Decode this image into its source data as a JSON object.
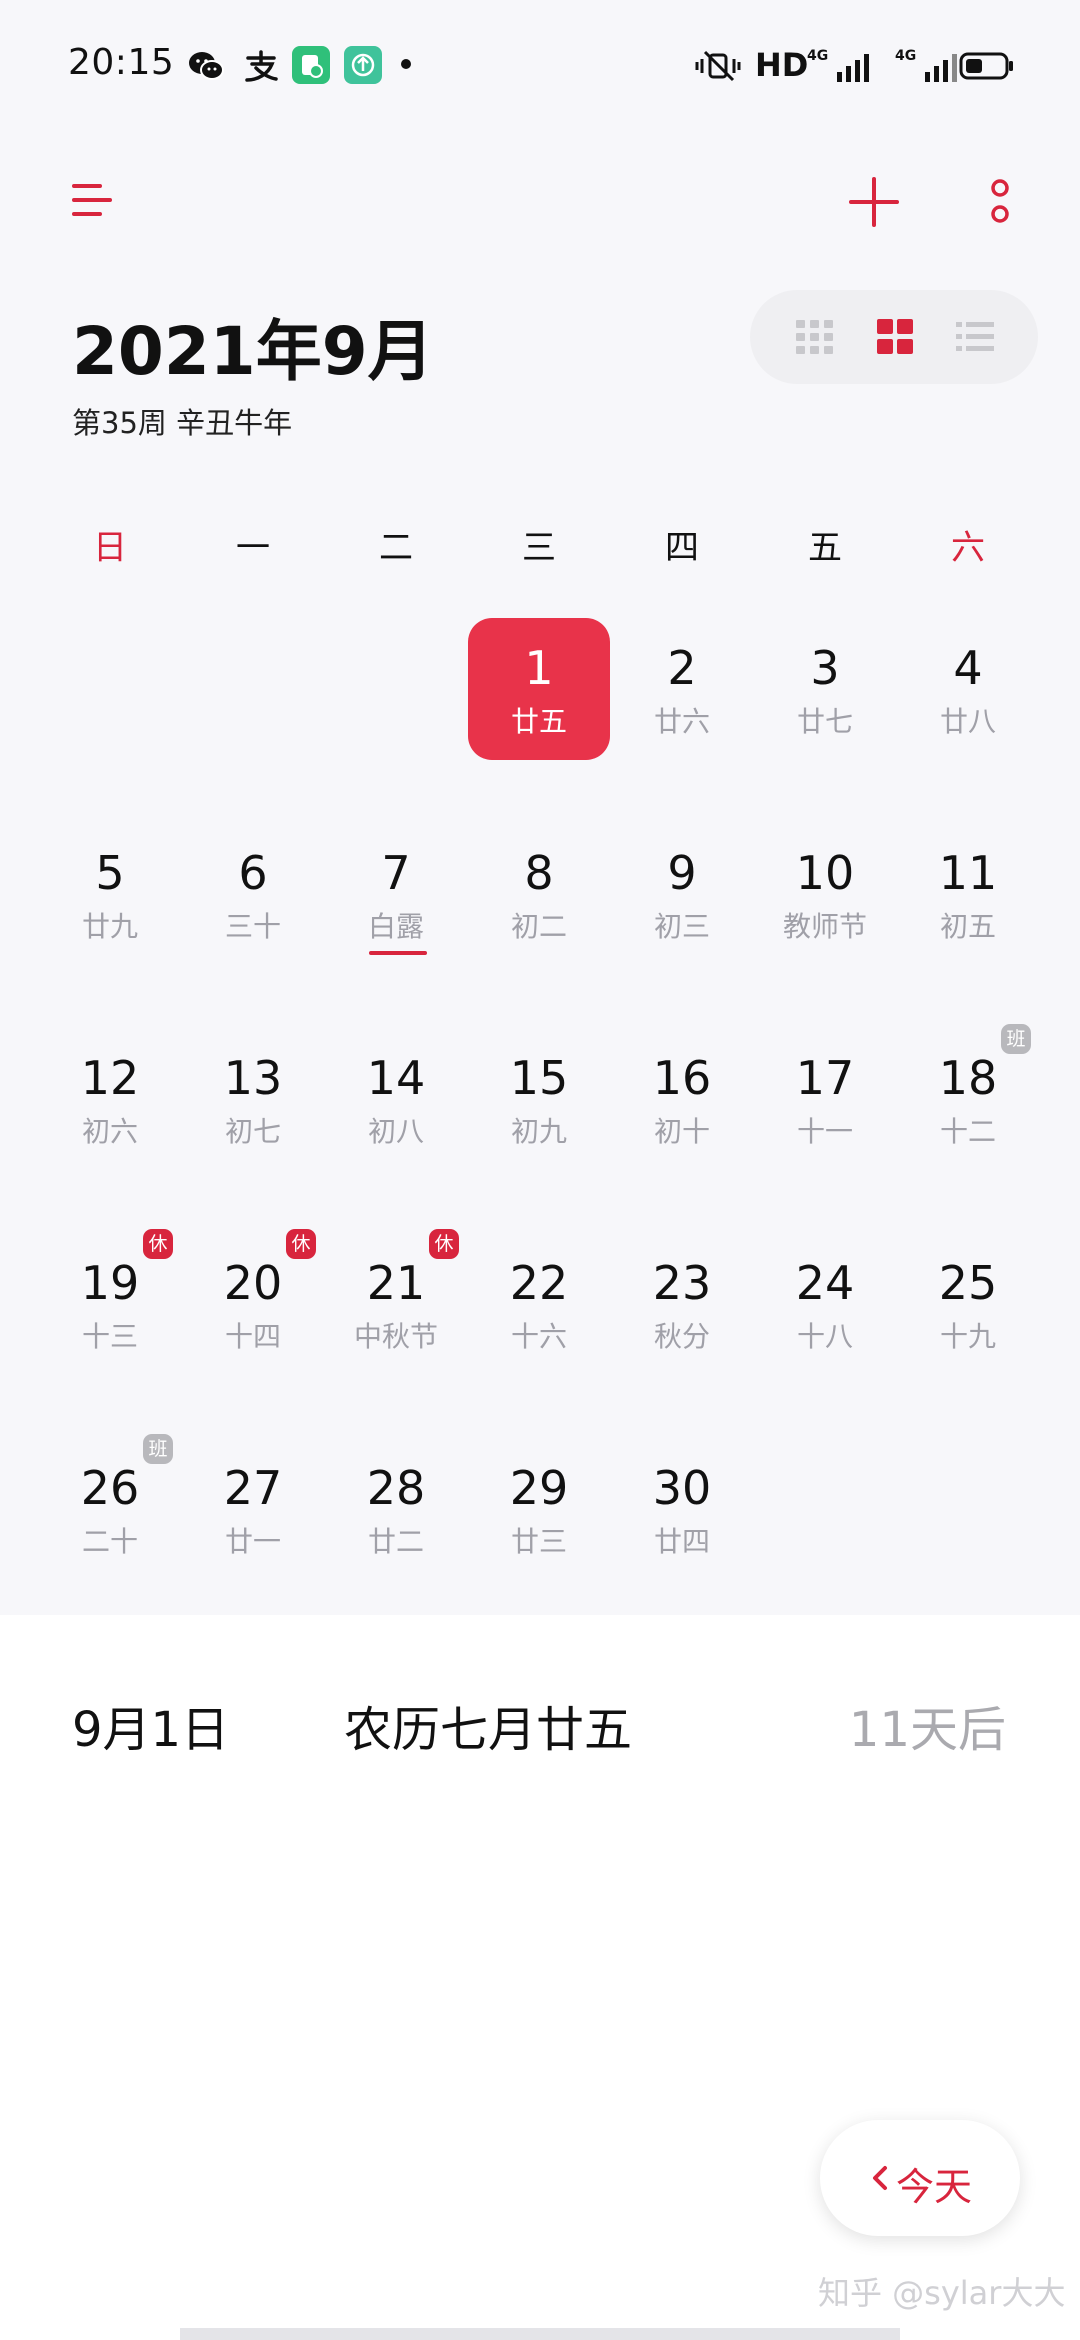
{
  "status_bar": {
    "time": "20:15",
    "left_icons": [
      "wechat-icon",
      "alipay-icon",
      "app-notification-icon",
      "upload-notification-icon",
      "dot-icon"
    ],
    "right_icons": [
      "vibrate-mute-icon",
      "hd-icon",
      "signal-4g-1-icon",
      "signal-4g-2-icon",
      "battery-icon"
    ],
    "hd_label": "HD",
    "network_label": "4G"
  },
  "header": {
    "menu_icon": "menu-icon",
    "add_icon": "add-icon",
    "more_icon": "more-icon",
    "title": "2021年9月",
    "subtitle": "第35周 辛丑牛年",
    "view_modes": [
      "year-grid-icon",
      "month-grid-icon",
      "list-icon"
    ],
    "active_view": "month-grid-icon"
  },
  "colors": {
    "accent": "#d8253d",
    "selected": "#e8334a",
    "lunar_text": "#a0a0a8",
    "work_badge": "#b8b8bc"
  },
  "weekdays": [
    "日",
    "一",
    "二",
    "三",
    "四",
    "五",
    "六"
  ],
  "weeks": [
    [
      null,
      null,
      null,
      {
        "d": "1",
        "l": "廿五",
        "selected": true
      },
      {
        "d": "2",
        "l": "廿六"
      },
      {
        "d": "3",
        "l": "廿七"
      },
      {
        "d": "4",
        "l": "廿八"
      }
    ],
    [
      {
        "d": "5",
        "l": "廿九"
      },
      {
        "d": "6",
        "l": "三十"
      },
      {
        "d": "7",
        "l": "白露",
        "underline": true
      },
      {
        "d": "8",
        "l": "初二"
      },
      {
        "d": "9",
        "l": "初三"
      },
      {
        "d": "10",
        "l": "教师节"
      },
      {
        "d": "11",
        "l": "初五"
      }
    ],
    [
      {
        "d": "12",
        "l": "初六"
      },
      {
        "d": "13",
        "l": "初七"
      },
      {
        "d": "14",
        "l": "初八"
      },
      {
        "d": "15",
        "l": "初九"
      },
      {
        "d": "16",
        "l": "初十"
      },
      {
        "d": "17",
        "l": "十一"
      },
      {
        "d": "18",
        "l": "十二",
        "badge": "班",
        "badge_type": "work"
      }
    ],
    [
      {
        "d": "19",
        "l": "十三",
        "badge": "休",
        "badge_type": "rest"
      },
      {
        "d": "20",
        "l": "十四",
        "badge": "休",
        "badge_type": "rest"
      },
      {
        "d": "21",
        "l": "中秋节",
        "badge": "休",
        "badge_type": "rest"
      },
      {
        "d": "22",
        "l": "十六"
      },
      {
        "d": "23",
        "l": "秋分"
      },
      {
        "d": "24",
        "l": "十八"
      },
      {
        "d": "25",
        "l": "十九"
      }
    ],
    [
      {
        "d": "26",
        "l": "二十",
        "badge": "班",
        "badge_type": "work"
      },
      {
        "d": "27",
        "l": "廿一"
      },
      {
        "d": "28",
        "l": "廿二"
      },
      {
        "d": "29",
        "l": "廿三"
      },
      {
        "d": "30",
        "l": "廿四"
      },
      null,
      null
    ]
  ],
  "info": {
    "date": "9月1日",
    "lunar": "农历七月廿五",
    "relative": "11天后"
  },
  "today_button": {
    "icon": "chevron-left-icon",
    "label": "今天"
  },
  "watermark": "知乎 @sylar大大"
}
